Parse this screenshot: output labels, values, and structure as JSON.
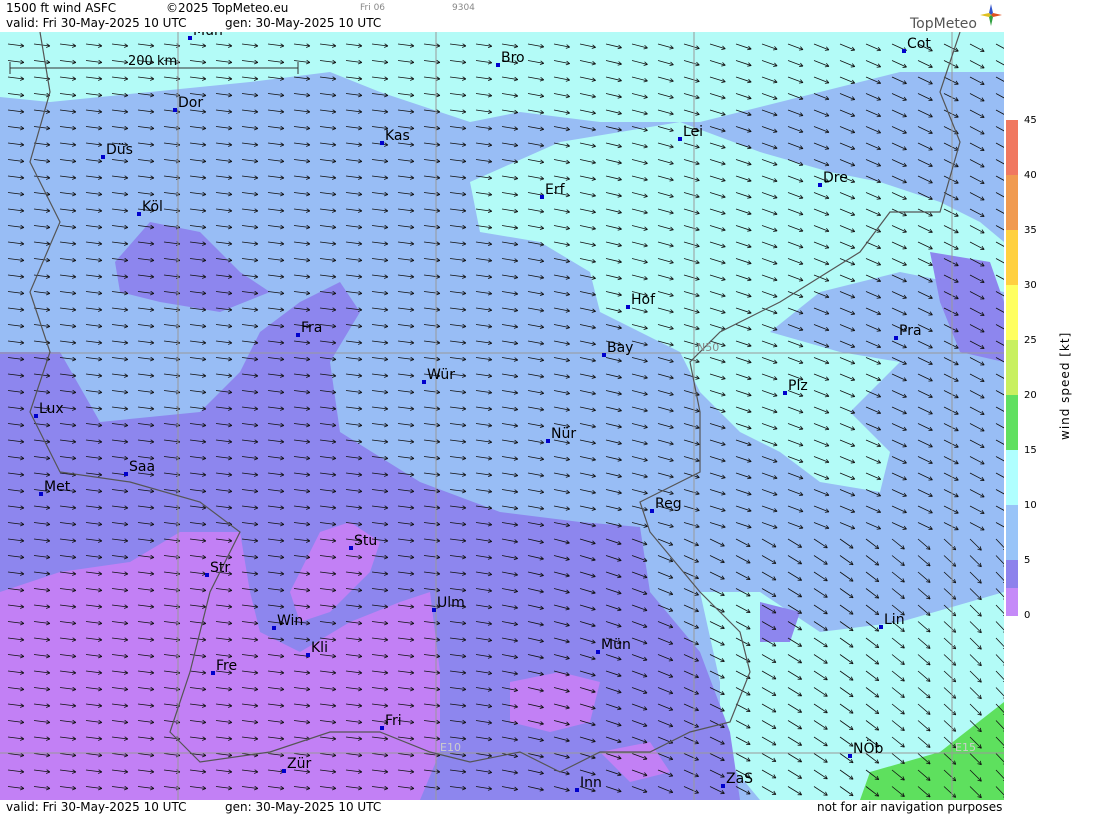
{
  "header": {
    "product": "1500 ft wind ASFC",
    "copyright": "©2025 TopMeteo.eu",
    "run_label": "Fri 06",
    "code": "9304",
    "valid": "valid:  Fri  30-May-2025  10 UTC",
    "generated": "gen:  30-May-2025 10 UTC",
    "brand": "TopMeteo"
  },
  "footer": {
    "valid": "valid:  Fri  30-May-2025  10 UTC",
    "generated": "gen:  30-May-2025 10 UTC",
    "disclaimer": "not for air navigation purposes"
  },
  "scale_bar": {
    "label": "200 km"
  },
  "grid_labels": {
    "lat": "N50",
    "lon1": "E10",
    "lon2": "E15"
  },
  "cities": [
    "Mün",
    "Bro",
    "Cot",
    "Dor",
    "Kas",
    "Lei",
    "Düs",
    "Dre",
    "Erf",
    "Köl",
    "Hof",
    "Fra",
    "Pra",
    "Bay",
    "Wür",
    "Plz",
    "Lux",
    "Nür",
    "Saa",
    "Met",
    "Reg",
    "Stu",
    "Str",
    "Ulm",
    "Win",
    "Lin",
    "Kli",
    "Mün",
    "Fre",
    "Fri",
    "NÖb",
    "Zür",
    "Inn",
    "ZaS"
  ],
  "legend": {
    "title": "wind  speed  [kt]",
    "ticks": [
      "45",
      "40",
      "35",
      "30",
      "25",
      "20",
      "15",
      "10",
      "5",
      "0"
    ],
    "colors": [
      "#f07860",
      "#f09a50",
      "#ffd040",
      "#ffff60",
      "#c8f060",
      "#60e060",
      "#b0ffff",
      "#99c4f8",
      "#8d82ec",
      "#c58af8"
    ]
  },
  "colors": {
    "calm": "#c280f5",
    "light": "#9a7cec",
    "moderate": "#98bdf5",
    "fresh": "#b3fbf7",
    "strong": "#5ee05e"
  }
}
